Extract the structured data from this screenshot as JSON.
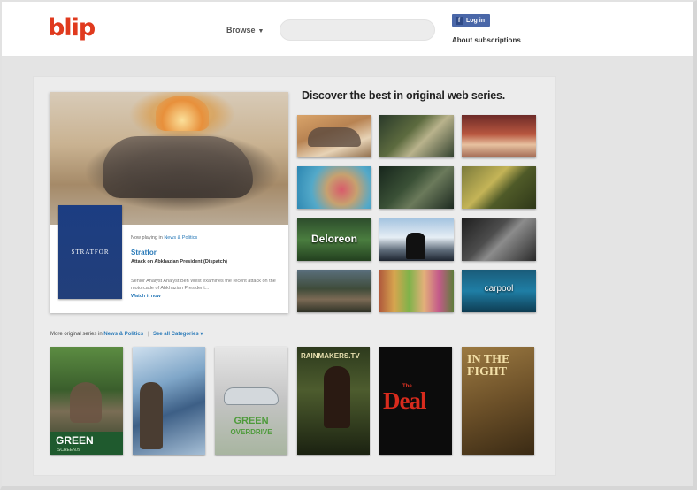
{
  "header": {
    "logo": "blip",
    "browse_label": "Browse",
    "search_placeholder": "",
    "fb_login_label": "Log in",
    "about_link": "About subscriptions"
  },
  "featured": {
    "now_playing_prefix": "Now playing in",
    "now_playing_category": "News & Politics",
    "show_logo_text": "STRATFOR",
    "show_title": "Stratfor",
    "episode_title": "Attack on Abkhazian President (Dispatch)",
    "description": "Senior Analyst Analyst Ben West examines the recent attack on the motorcade of Abkhazian President...",
    "watch_link": "Watch it now"
  },
  "discover": {
    "heading": "Discover the best in original web series.",
    "thumbnails": [
      {
        "name": "series-thumb-1",
        "label": ""
      },
      {
        "name": "series-thumb-2",
        "label": ""
      },
      {
        "name": "series-thumb-3",
        "label": ""
      },
      {
        "name": "series-thumb-4",
        "label": ""
      },
      {
        "name": "series-thumb-5",
        "label": ""
      },
      {
        "name": "series-thumb-6",
        "label": ""
      },
      {
        "name": "series-thumb-deloreon",
        "label": "Deloreon"
      },
      {
        "name": "series-thumb-8",
        "label": ""
      },
      {
        "name": "series-thumb-9",
        "label": ""
      },
      {
        "name": "series-thumb-10",
        "label": ""
      },
      {
        "name": "series-thumb-11",
        "label": ""
      },
      {
        "name": "series-thumb-carpool",
        "label": "carpool"
      }
    ]
  },
  "more_series": {
    "prefix": "More original series in",
    "category_link": "News & Politics",
    "separator": "|",
    "see_all_link": "See all Categories",
    "posters": [
      {
        "name": "poster-green",
        "title": "GREEN",
        "subtitle": "SCREEN.tv"
      },
      {
        "name": "poster-2",
        "title": "",
        "subtitle": ""
      },
      {
        "name": "poster-green-overdrive",
        "title": "GREEN",
        "subtitle": "OVERDRIVE"
      },
      {
        "name": "poster-rainmakers",
        "title": "RAINMAKERS.TV",
        "subtitle": ""
      },
      {
        "name": "poster-the-deal",
        "title": "Deal",
        "subtitle": "The"
      },
      {
        "name": "poster-in-the-fight",
        "title": "IN THE FIGHT",
        "subtitle": ""
      }
    ]
  },
  "colors": {
    "brand_red": "#e03a1e",
    "link_blue": "#2a7ab8",
    "facebook_blue": "#4a67a8"
  }
}
